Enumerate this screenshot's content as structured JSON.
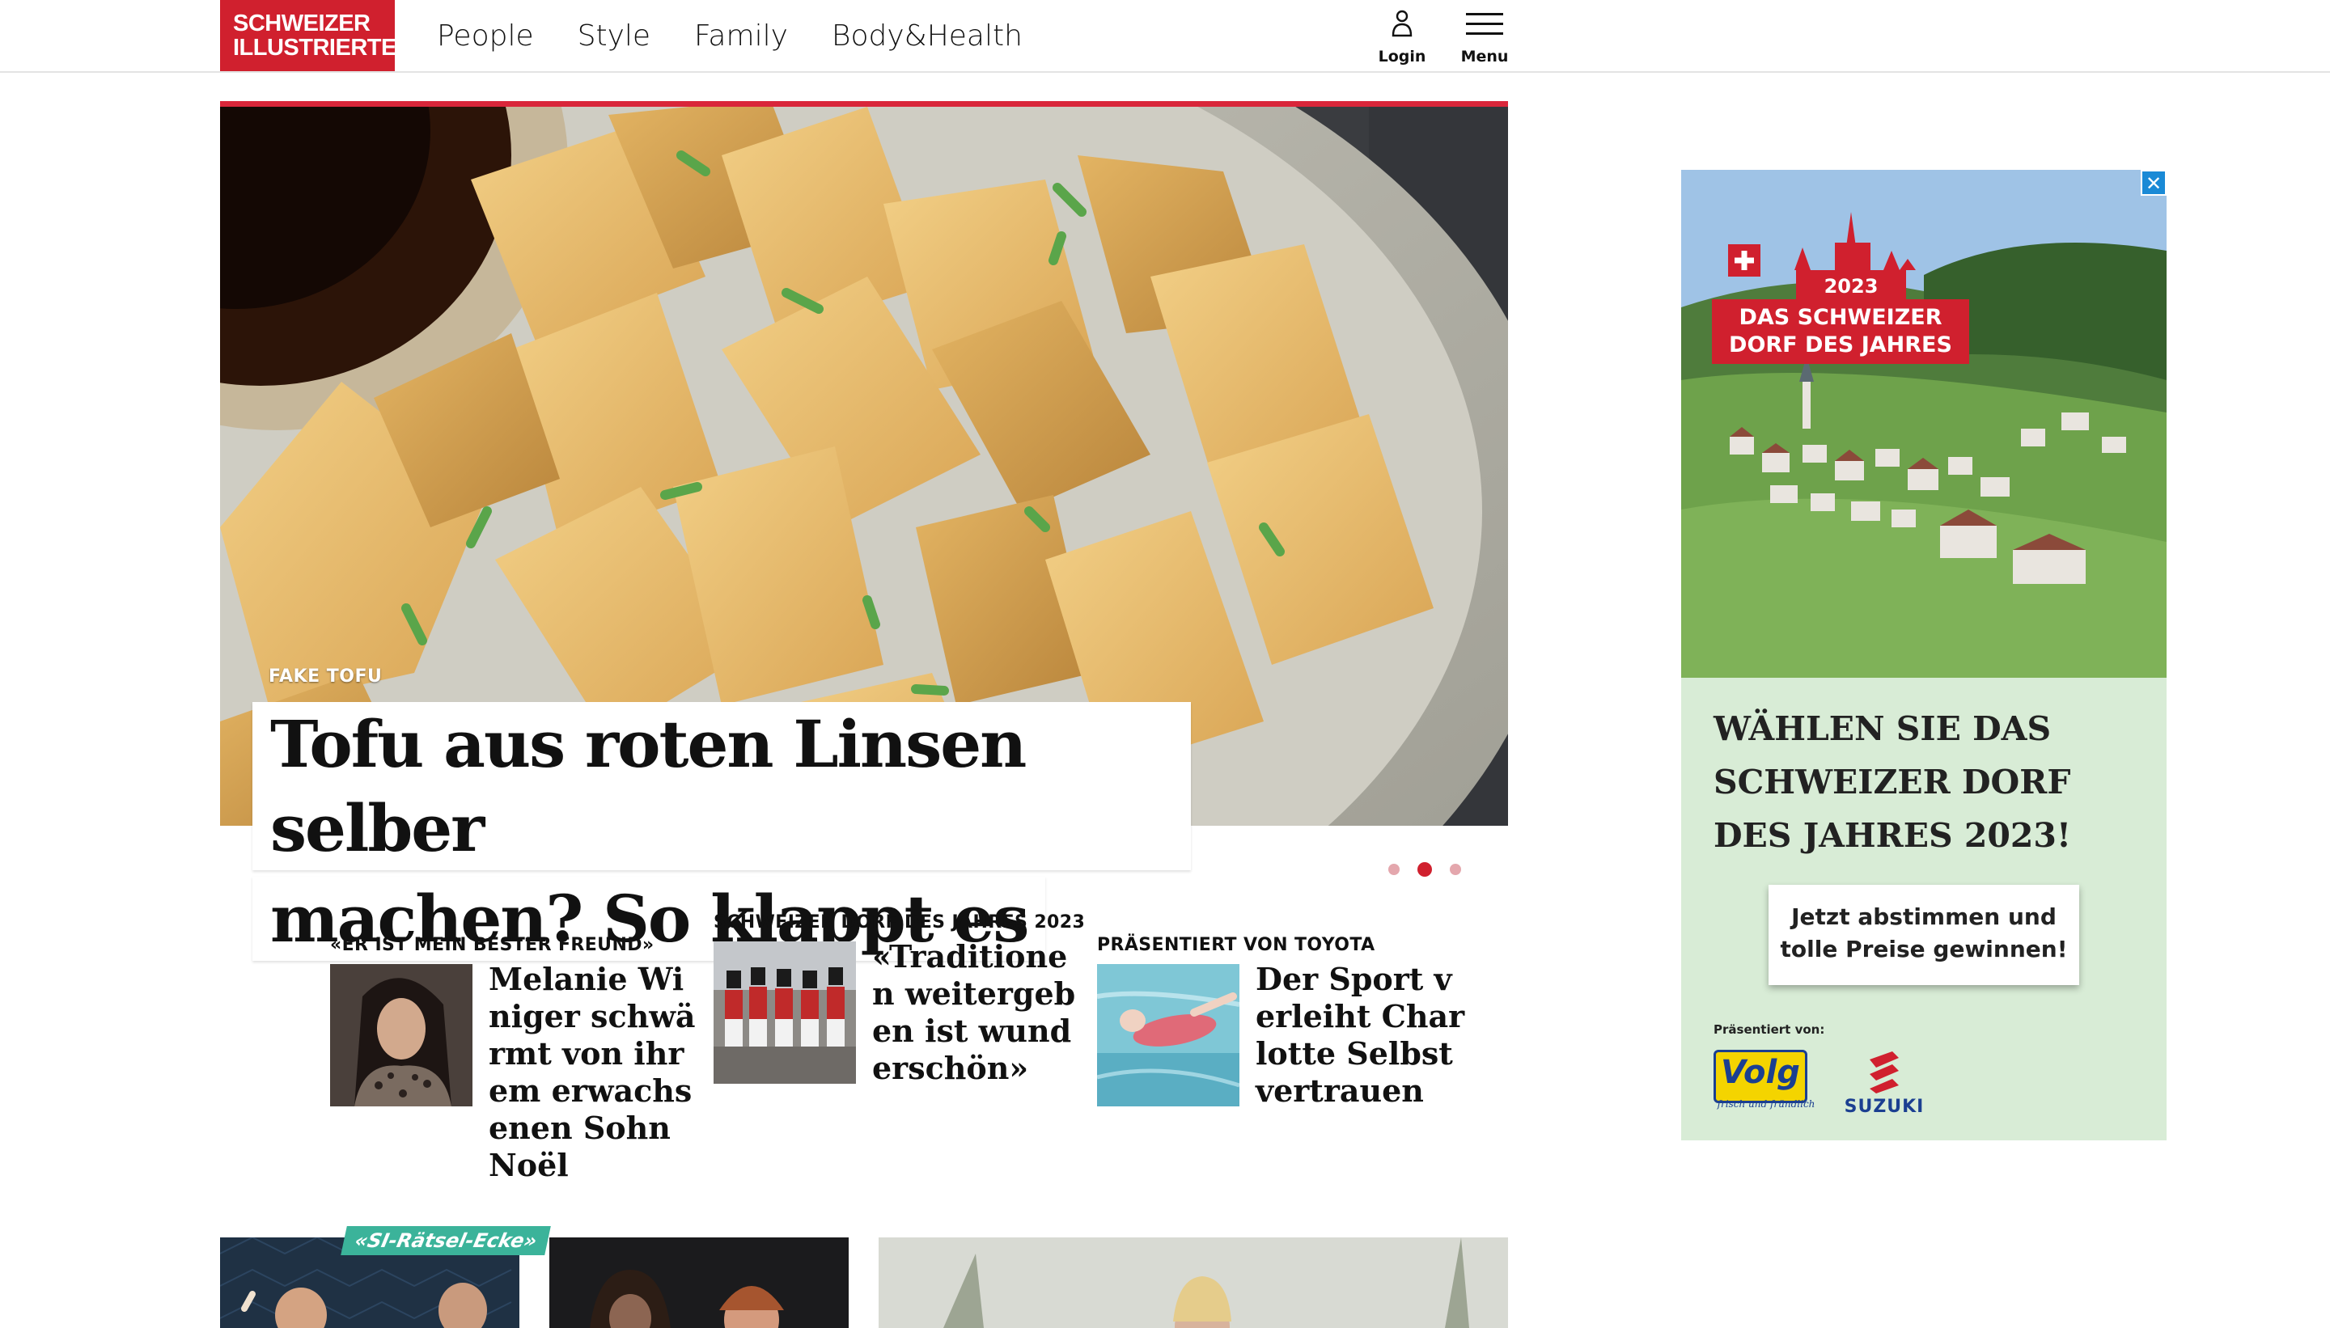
{
  "header": {
    "logo_line1": "SCHWEIZER",
    "logo_line2": "ILLUSTRIERTE",
    "nav": [
      "People",
      "Style",
      "Family",
      "Body&Health"
    ],
    "login_label": "Login",
    "menu_label": "Menu"
  },
  "hero": {
    "kicker": "FAKE TOFU",
    "title_line1": "Tofu aus roten Linsen selber",
    "title_line2": "machen? So klappt es",
    "slides_total": 3,
    "active_slide": 2
  },
  "teasers": [
    {
      "kicker": "«Er ist mein bester Freund»",
      "title": "Melanie Winiger schwärmt von ihrem erwachsenen Sohn Noël"
    },
    {
      "kicker": "Schweizer Dorf des Jahres 2023",
      "title": "«Traditionen weitergeben ist wunderschön»"
    },
    {
      "kicker": "Präsentiert von Toyota",
      "title": "Der Sport verleiht Charlotte Selbstvertrauen"
    }
  ],
  "cards": {
    "raetsel_tag": "«SI-Rätsel-Ecke»"
  },
  "ad": {
    "close": "✕",
    "badge_year": "2023",
    "badge_name": "DAS SCHWEIZER DORF DES JAHRES",
    "headline": "WÄHLEN SIE DAS SCHWEIZER DORF DES JAHRES 2023!",
    "cta": "Jetzt abstimmen und tolle Preise gewinnen!",
    "sponsor_label": "Präsentiert von:",
    "sponsor1": "Volg",
    "sponsor1_sub": "frisch und fründlich",
    "sponsor2": "SUZUKI"
  },
  "colors": {
    "brand_red": "#d0202e",
    "accent_teal": "#3bb39a",
    "ad_bg": "#d8ecd6"
  }
}
